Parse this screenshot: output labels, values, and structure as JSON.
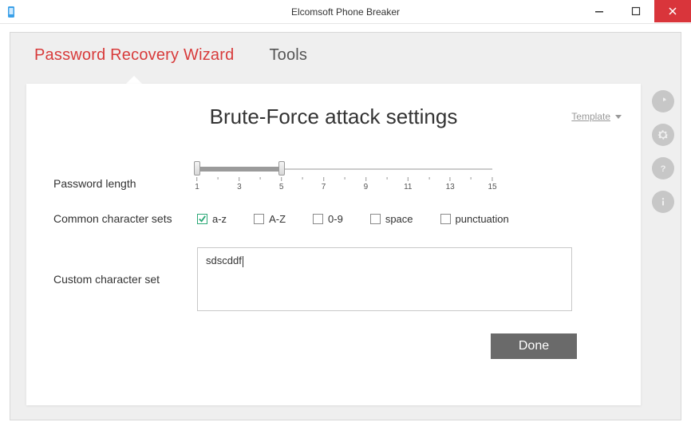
{
  "window": {
    "title": "Elcomsoft Phone Breaker"
  },
  "tabs": {
    "recovery": "Password Recovery Wizard",
    "tools": "Tools"
  },
  "page": {
    "title": "Brute-Force attack settings",
    "template_label": "Template"
  },
  "password_length": {
    "label": "Password length",
    "min": 1,
    "max": 15,
    "value_low": 1,
    "value_high": 5,
    "ticks": [
      "1",
      "",
      "3",
      "",
      "5",
      "",
      "7",
      "",
      "9",
      "",
      "11",
      "",
      "13",
      "",
      "15"
    ]
  },
  "charsets": {
    "label": "Common character sets",
    "options": [
      {
        "key": "az",
        "label": "a-z",
        "checked": true
      },
      {
        "key": "AZ",
        "label": "A-Z",
        "checked": false
      },
      {
        "key": "num",
        "label": "0-9",
        "checked": false
      },
      {
        "key": "space",
        "label": "space",
        "checked": false
      },
      {
        "key": "punct",
        "label": "punctuation",
        "checked": false
      }
    ]
  },
  "custom": {
    "label": "Custom character set",
    "value": "sdscddf"
  },
  "buttons": {
    "done": "Done"
  },
  "side_icons": [
    "clock-icon",
    "gear-icon",
    "help-icon",
    "info-icon"
  ]
}
